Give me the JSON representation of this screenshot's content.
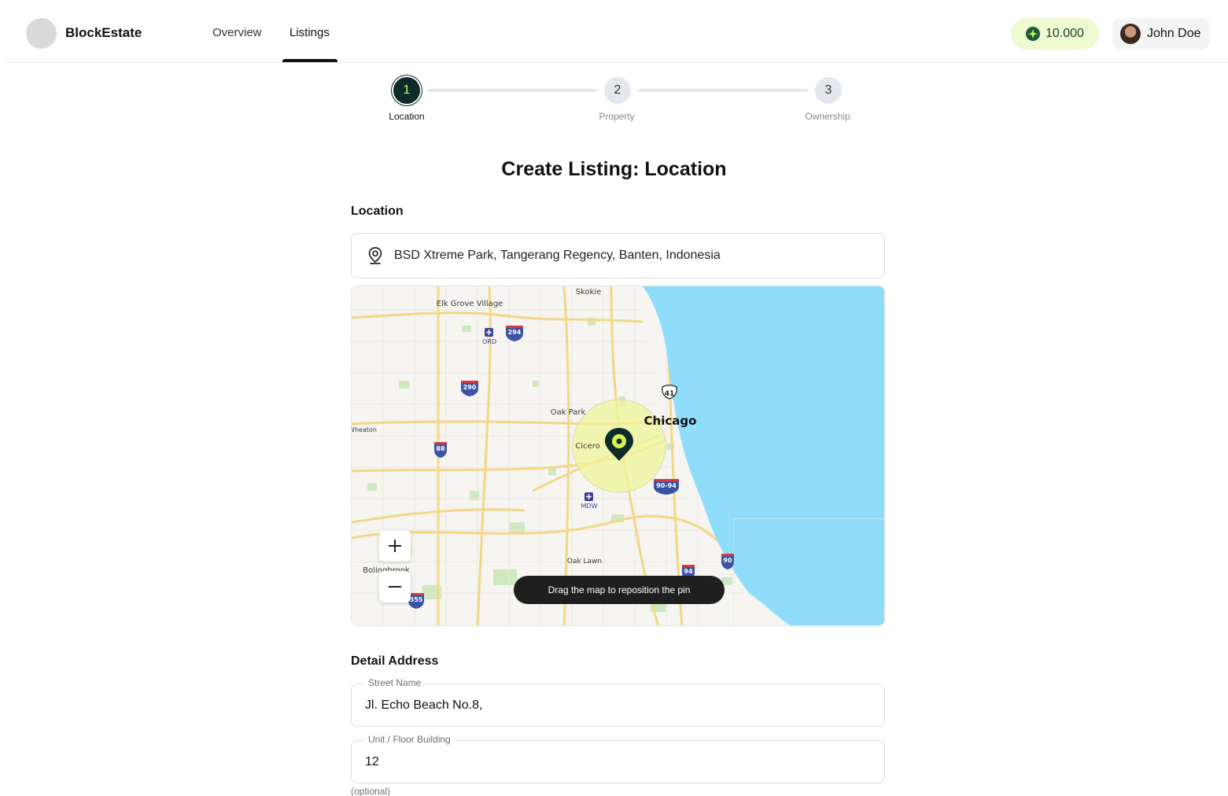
{
  "header": {
    "brand": "BlockEstate",
    "nav": [
      {
        "label": "Overview"
      },
      {
        "label": "Listings",
        "active": true
      }
    ],
    "balance": "10.000",
    "balance_icon": "sparkle-icon",
    "user_name": "John Doe"
  },
  "stepper": {
    "steps": [
      {
        "number": "1",
        "label": "Location",
        "active": true
      },
      {
        "number": "2",
        "label": "Property",
        "active": false
      },
      {
        "number": "3",
        "label": "Ownership",
        "active": false
      }
    ]
  },
  "page": {
    "title": "Create Listing: Location",
    "location_label": "Location",
    "location_value": "BSD Xtreme Park, Tangerang Regency, Banten, Indonesia",
    "location_icon": "map-pin-icon"
  },
  "map": {
    "tip": "Drag the map to reposition the pin",
    "labels": [
      "Skokie",
      "Elk Grove Village",
      "ORD",
      "Oak Park",
      "Chicago",
      "Cicero",
      "MDW",
      "Oak Lawn",
      "Bolingbrook",
      "Wheaton"
    ],
    "highways": [
      "294",
      "290",
      "88",
      "41",
      "90-94",
      "94",
      "90",
      "355"
    ],
    "zoom_in_icon": "plus-icon",
    "zoom_out_icon": "minus-icon"
  },
  "detail": {
    "title": "Detail Address",
    "street_label": "Street Name",
    "street_value": "Jl. Echo Beach No.8,",
    "unit_label": "Unit / Floor Building",
    "unit_value": "12",
    "optional_note": "(optional)"
  },
  "colors": {
    "accent": "#d8f24c",
    "dark": "#0d2b2b",
    "water": "#8fdcfb",
    "balance_bg": "#eefad0"
  }
}
